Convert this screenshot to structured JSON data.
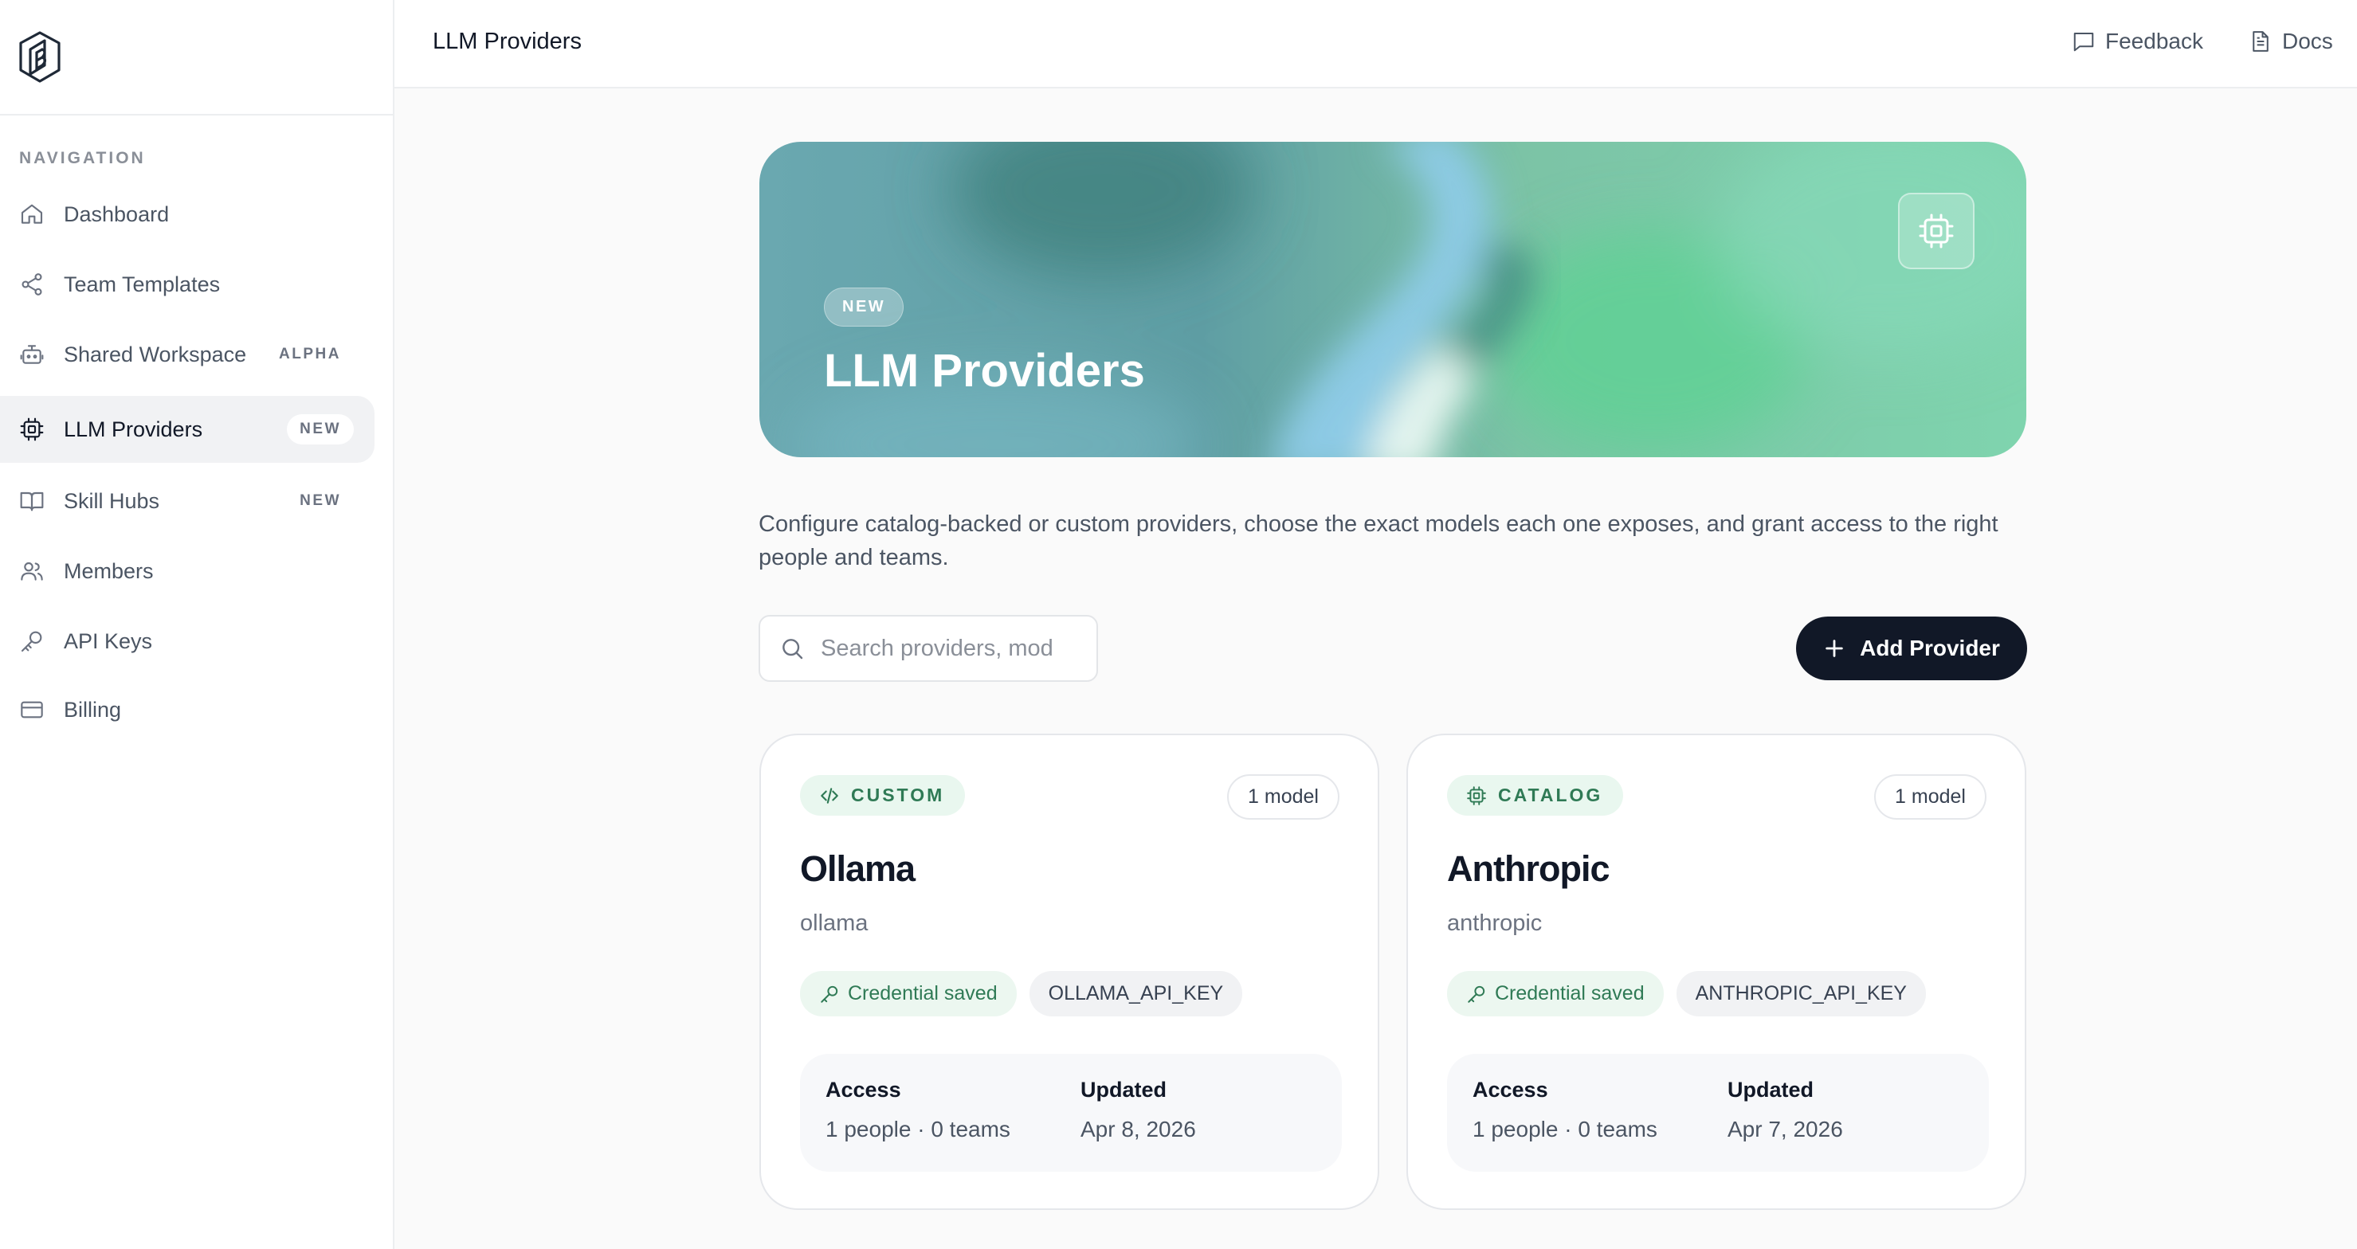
{
  "sidebar": {
    "nav_heading": "NAVIGATION",
    "items": [
      {
        "label": "Dashboard",
        "icon": "home-icon",
        "tag": ""
      },
      {
        "label": "Team Templates",
        "icon": "share-icon",
        "tag": ""
      },
      {
        "label": "Shared Workspace",
        "icon": "bot-icon",
        "tag": "ALPHA"
      },
      {
        "label": "LLM Providers",
        "icon": "chip-icon",
        "tag": "NEW",
        "active": true
      },
      {
        "label": "Skill Hubs",
        "icon": "book-icon",
        "tag": "NEW"
      },
      {
        "label": "Members",
        "icon": "users-icon",
        "tag": ""
      },
      {
        "label": "API Keys",
        "icon": "key-icon",
        "tag": ""
      },
      {
        "label": "Billing",
        "icon": "credit-card-icon",
        "tag": ""
      }
    ]
  },
  "header": {
    "title": "LLM Providers",
    "feedback_label": "Feedback",
    "docs_label": "Docs"
  },
  "hero": {
    "badge": "NEW",
    "title": "LLM Providers",
    "icon": "chip-icon"
  },
  "main": {
    "description": "Configure catalog-backed or custom providers, choose the exact models each one exposes, and grant access to the right people and teams.",
    "search": {
      "placeholder": "Search providers, models",
      "value": ""
    },
    "add_button_label": "Add Provider"
  },
  "providers": [
    {
      "type": "CUSTOM",
      "type_icon": "code-icon",
      "model_count": "1 model",
      "name": "Ollama",
      "slug": "ollama",
      "credential_label": "Credential saved",
      "env_key": "OLLAMA_API_KEY",
      "access_label": "Access",
      "access_value": "1 people · 0 teams",
      "updated_label": "Updated",
      "updated_value": "Apr 8, 2026"
    },
    {
      "type": "CATALOG",
      "type_icon": "chip-icon",
      "model_count": "1 model",
      "name": "Anthropic",
      "slug": "anthropic",
      "credential_label": "Credential saved",
      "env_key": "ANTHROPIC_API_KEY",
      "access_label": "Access",
      "access_value": "1 people · 0 teams",
      "updated_label": "Updated",
      "updated_value": "Apr 7, 2026"
    }
  ],
  "colors": {
    "primary_button": "#111827",
    "accent_green": "#2f7a55",
    "accent_green_bg": "#e9f7ef"
  }
}
